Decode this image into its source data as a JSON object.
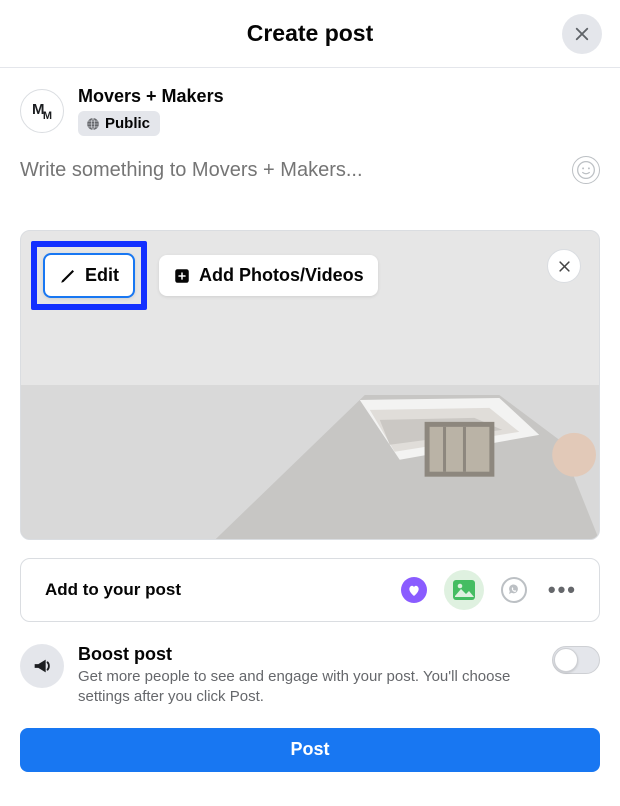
{
  "header": {
    "title": "Create post"
  },
  "profile": {
    "name": "Movers + Makers",
    "avatar_m1": "M",
    "avatar_m2": "M",
    "privacy": "Public"
  },
  "composer": {
    "placeholder": "Write something to Movers + Makers..."
  },
  "media": {
    "edit_label": "Edit",
    "add_label": "Add Photos/Videos"
  },
  "add_to_post": {
    "label": "Add to your post"
  },
  "boost": {
    "title": "Boost post",
    "desc": "Get more people to see and engage with your post. You'll choose settings after you click Post."
  },
  "actions": {
    "post_label": "Post"
  }
}
